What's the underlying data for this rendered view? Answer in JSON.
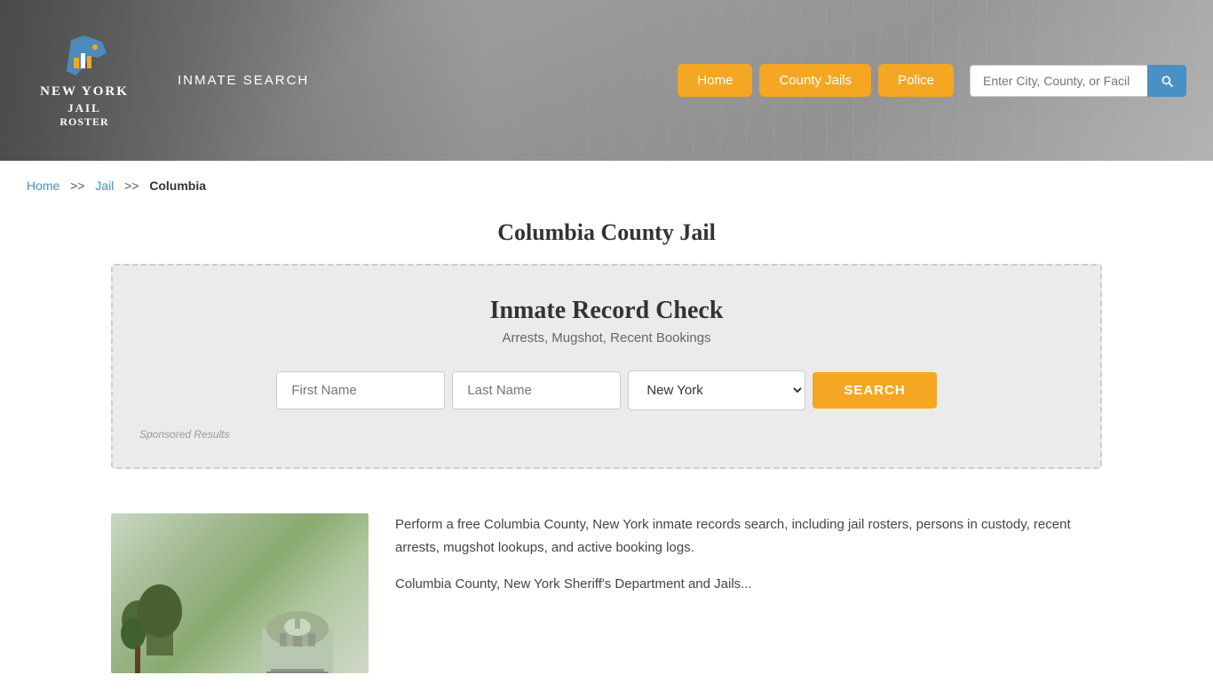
{
  "header": {
    "logo_line1": "NEW YORK",
    "logo_line2": "JAIL",
    "logo_line3": "ROSTER",
    "inmate_search_label": "INMATE SEARCH",
    "nav_home": "Home",
    "nav_county_jails": "County Jails",
    "nav_police": "Police",
    "search_placeholder": "Enter City, County, or Facil"
  },
  "breadcrumb": {
    "home": "Home",
    "jail": "Jail",
    "current": "Columbia"
  },
  "main": {
    "page_title": "Columbia County Jail",
    "record_check": {
      "title": "Inmate Record Check",
      "subtitle": "Arrests, Mugshot, Recent Bookings",
      "first_name_placeholder": "First Name",
      "last_name_placeholder": "Last Name",
      "state_value": "New York",
      "search_btn_label": "SEARCH",
      "sponsored_label": "Sponsored Results"
    },
    "lower_text_1": "Perform a free Columbia County, New York inmate records search, including jail rosters, persons in custody, recent arrests, mugshot lookups, and active booking logs.",
    "lower_text_2_partial": "Columbia County, New York Sheriff's Department and Jails..."
  }
}
